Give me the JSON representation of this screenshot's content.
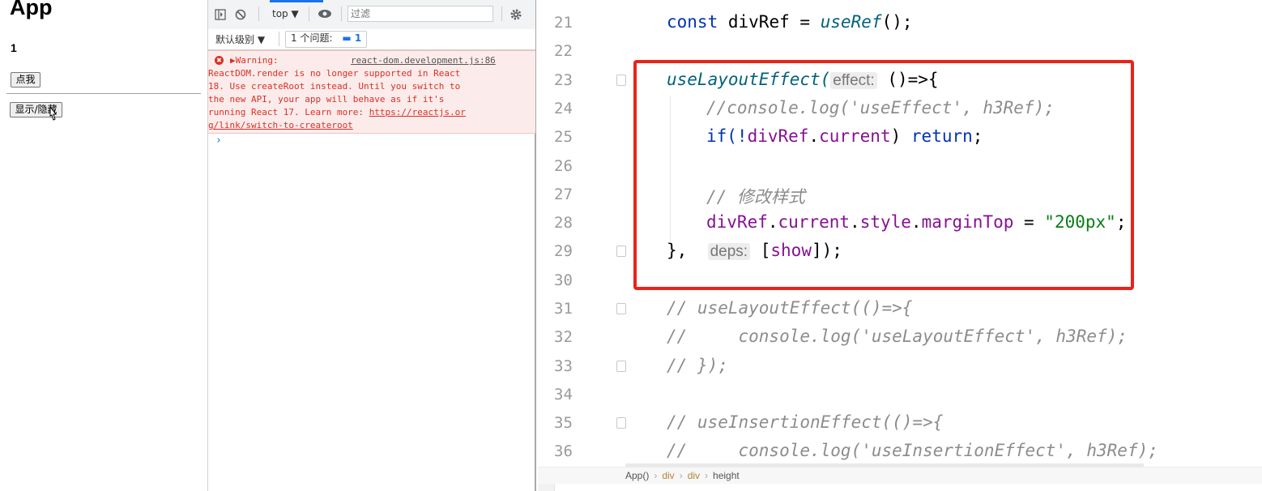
{
  "app": {
    "title": "App",
    "count": "1",
    "click_button": "点我",
    "toggle_button": "显示/隐藏"
  },
  "devtools": {
    "context": "top ▼",
    "filter_placeholder": "过滤",
    "levels": "默认级别 ▼",
    "issues_label": "1 个问题:",
    "issues_count": "1",
    "warning_label": "▶Warning:",
    "warning_source": "react-dom.development.js:86",
    "warning_lines": [
      "ReactDOM.render is no longer supported in React",
      "18. Use createRoot instead. Until you switch to",
      "the new API, your app will behave as if it's",
      "running React 17. Learn more: "
    ],
    "warning_link_1": "https://reactjs.or",
    "warning_link_2": "g/link/switch-to-createroot",
    "prompt": "›",
    "error_icon": "✖"
  },
  "editor": {
    "line_numbers": [
      "21",
      "22",
      "23",
      "24",
      "25",
      "26",
      "27",
      "28",
      "29",
      "30",
      "31",
      "32",
      "33",
      "34",
      "35",
      "36"
    ],
    "hint_effect": "effect:",
    "hint_deps": "deps:",
    "breadcrumb": [
      "App()",
      "div",
      "div",
      "height"
    ],
    "lines": {
      "l21": [
        "const",
        "divRef",
        "=",
        "useRef",
        "();"
      ],
      "l23": [
        "useLayoutEffect(",
        "()=>{"
      ],
      "l24": "//console.log('useEffect', h3Ref);",
      "l25": [
        "if(!",
        "divRef",
        ".",
        "current",
        ") ",
        "return",
        ";"
      ],
      "l27": "// 修改样式",
      "l28": [
        "divRef",
        ".",
        "current",
        ".",
        "style",
        ".",
        "marginTop",
        " = ",
        "\"200px\"",
        ";"
      ],
      "l29": [
        "},",
        "[",
        "show",
        "]);"
      ],
      "l31": "// useLayoutEffect(()=>{",
      "l32": "//     console.log('useLayoutEffect', h3Ref);",
      "l33": "// });",
      "l35": "// useInsertionEffect(()=>{",
      "l36": "//     console.log('useInsertionEffect', h3Ref);"
    }
  },
  "colors": {
    "highlight_border": "#e8231b",
    "devtools_blue": "#1a73e8",
    "warning_red": "#d93025"
  }
}
